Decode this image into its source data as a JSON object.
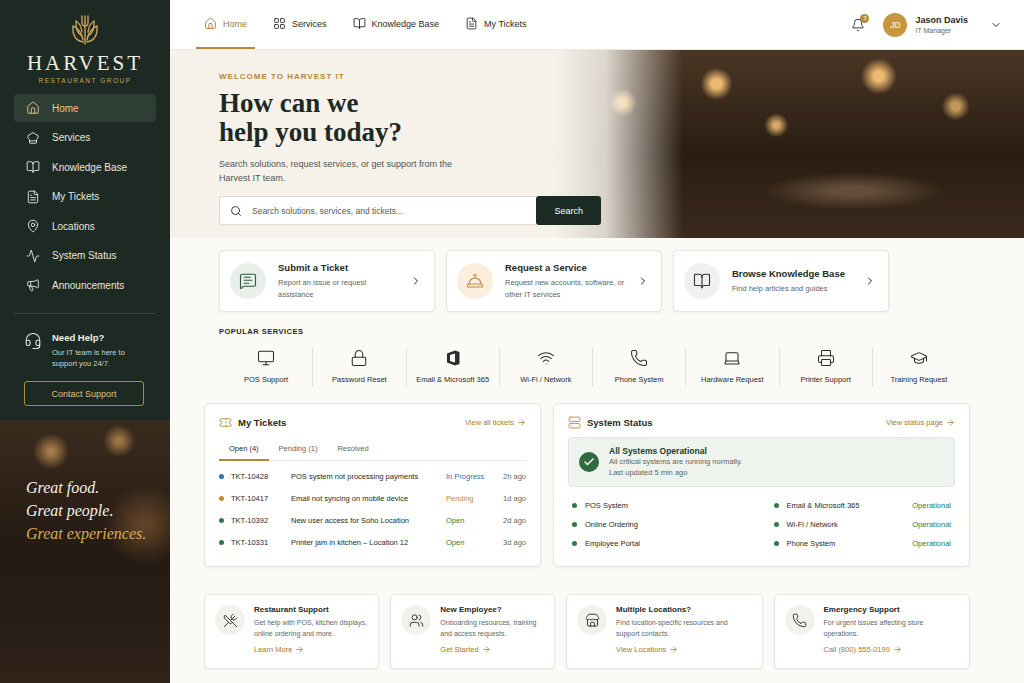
{
  "brand": {
    "name": "HARVEST",
    "subtitle": "RESTAURANT GROUP"
  },
  "sidebar": {
    "items": [
      {
        "label": "Home",
        "selected": true
      },
      {
        "label": "Services",
        "selected": false
      },
      {
        "label": "Knowledge Base",
        "selected": false
      },
      {
        "label": "My Tickets",
        "selected": false
      },
      {
        "label": "Locations",
        "selected": false
      },
      {
        "label": "System Status",
        "selected": false
      },
      {
        "label": "Announcements",
        "selected": false
      }
    ],
    "help": {
      "title": "Need Help?",
      "text": "Our IT team is here to support you 24/7.",
      "button": "Contact Support"
    },
    "tagline": [
      "Great food.",
      "Great people.",
      "Great experiences."
    ]
  },
  "topnav": {
    "items": [
      {
        "label": "Home",
        "selected": true
      },
      {
        "label": "Services",
        "selected": false
      },
      {
        "label": "Knowledge Base",
        "selected": false
      },
      {
        "label": "My Tickets",
        "selected": false
      }
    ],
    "notifications": "3",
    "user": {
      "initials": "JD",
      "name": "Jason Davis",
      "role": "IT Manager"
    }
  },
  "hero": {
    "eyebrow": "WELCOME TO HARVEST IT",
    "title": [
      "How can we",
      "help you today?"
    ],
    "description": "Search solutions, request services, or get support from the Harvest IT team.",
    "search": {
      "placeholder": "Search solutions, services, and tickets...",
      "button": "Search"
    }
  },
  "quick_actions": [
    {
      "title": "Submit a Ticket",
      "description": "Report an issue or request assistance"
    },
    {
      "title": "Request a Service",
      "description": "Request new accounts, software, or other IT services"
    },
    {
      "title": "Browse Knowledge Base",
      "description": "Find help articles and guides"
    }
  ],
  "popular_services": {
    "title": "POPULAR SERVICES",
    "items": [
      "POS Support",
      "Password Reset",
      "Email & Microsoft 365",
      "Wi-Fi / Network",
      "Phone System",
      "Hardware Request",
      "Printer Support",
      "Training Request"
    ]
  },
  "tickets": {
    "title": "My Tickets",
    "link": "View all tickets",
    "tabs": [
      {
        "label": "Open (4)",
        "selected": true
      },
      {
        "label": "Pending (1)",
        "selected": false
      },
      {
        "label": "Resolved",
        "selected": false
      }
    ],
    "rows": [
      {
        "id": "TKT-10428",
        "title": "POS system not processing payments",
        "status": "In Progress",
        "time": "2h ago",
        "color": "#2f6db3"
      },
      {
        "id": "TKT-10417",
        "title": "Email not syncing on mobile device",
        "status": "Pending",
        "time": "1d ago",
        "color": "#c48a2c"
      },
      {
        "id": "TKT-10392",
        "title": "New user access for Soho Location",
        "status": "Open",
        "time": "2d ago",
        "color": "#2f7a45"
      },
      {
        "id": "TKT-10331",
        "title": "Printer jam in kitchen – Location 12",
        "status": "Open",
        "time": "3d ago",
        "color": "#2f7a45"
      }
    ]
  },
  "system_status": {
    "title": "System Status",
    "link": "View status page",
    "banner": {
      "title": "All Systems Operational",
      "text": "All critical systems are running normally.",
      "updated": "Last updated 5 min ago"
    },
    "systems": [
      {
        "name": "POS System"
      },
      {
        "name": "Online Ordering"
      },
      {
        "name": "Employee Portal"
      },
      {
        "name": "Email & Microsoft 365",
        "status": "Operational"
      },
      {
        "name": "Wi-Fi / Network",
        "status": "Operational"
      },
      {
        "name": "Phone System",
        "status": "Operational"
      }
    ]
  },
  "help_cards": [
    {
      "title": "Restaurant Support",
      "description": "Get help with POS, kitchen displays, online ordering and more.",
      "link": "Learn More"
    },
    {
      "title": "New Employee?",
      "description": "Onboarding resources, training and access requests.",
      "link": "Get Started"
    },
    {
      "title": "Multiple Locations?",
      "description": "Find location-specific resources and support contacts.",
      "link": "View Locations"
    },
    {
      "title": "Emergency Support",
      "description": "For urgent issues affecting store operations.",
      "link": "Call (800) 555-0199"
    }
  ]
}
